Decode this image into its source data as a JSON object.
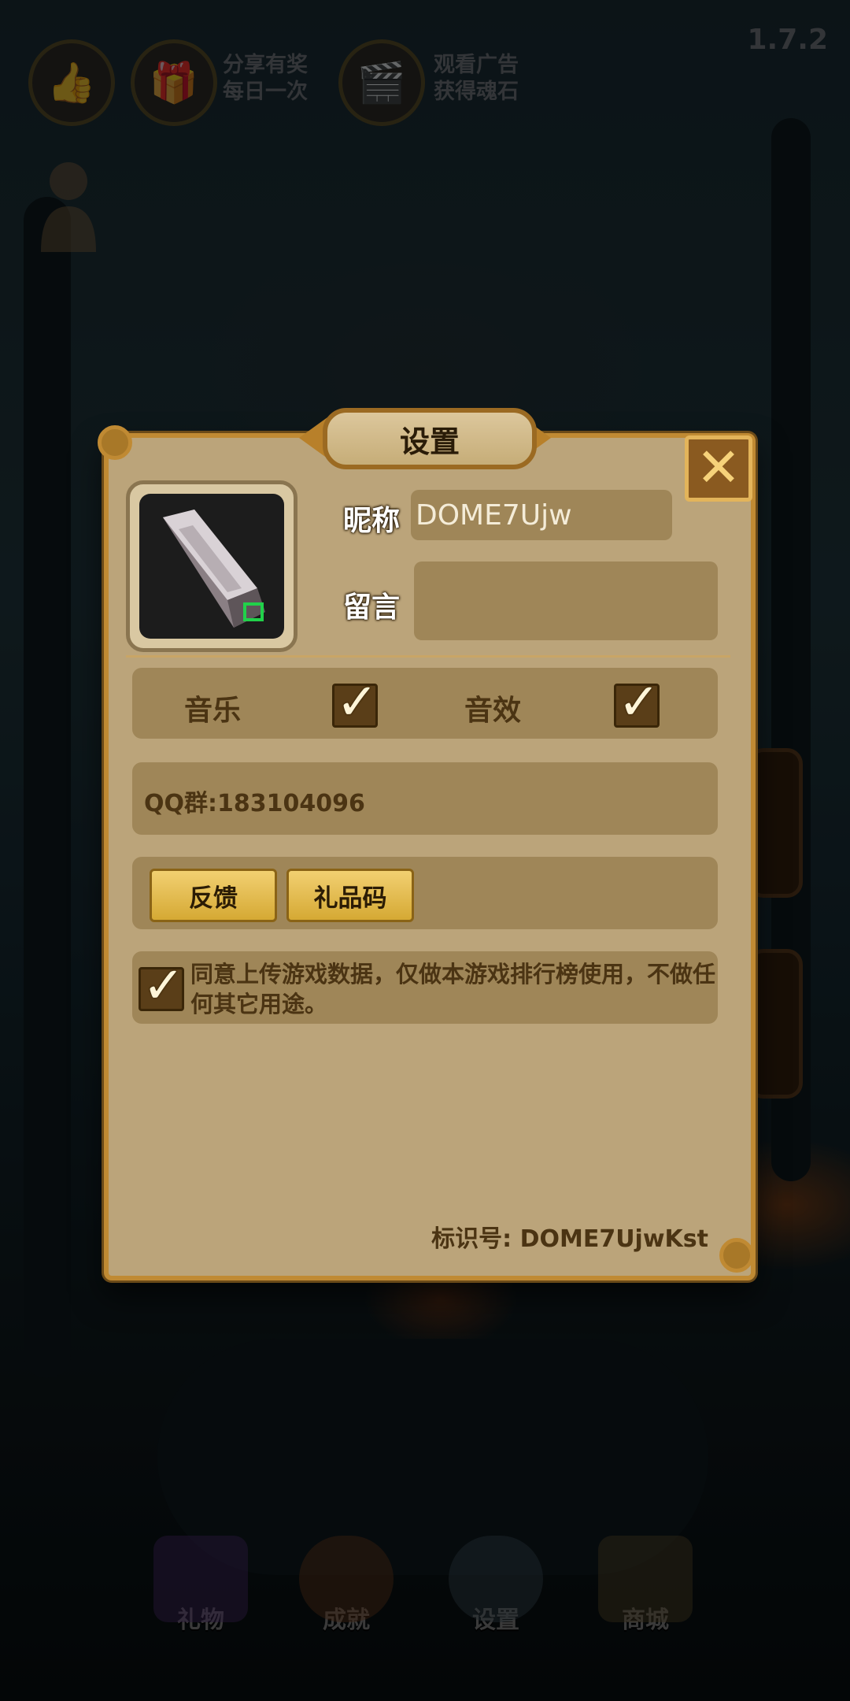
{
  "top": {
    "share": {
      "line1": "分享有奖",
      "line2": "每日一次"
    },
    "ad": {
      "line1": "观看广告",
      "line2": "获得魂石"
    },
    "version": "1.7.2"
  },
  "dialog": {
    "title": "设置",
    "nickname_label": "昵称",
    "nickname_value": "DOME7Ujw",
    "message_label": "留言",
    "message_value": "",
    "music_label": "音乐",
    "music_checked": true,
    "sfx_label": "音效",
    "sfx_checked": true,
    "qq_group": "QQ群:183104096",
    "feedback_button": "反馈",
    "gift_code_button": "礼品码",
    "agree_text": "同意上传游戏数据，仅做本游戏排行榜使用，不做任何其它用途。",
    "agree_checked": true,
    "identifier": "标识号: DOME7UjwKst"
  },
  "bottom_nav": {
    "gift": "礼物",
    "achievement": "成就",
    "settings": "设置",
    "shop": "商城"
  },
  "colors": {
    "panel": "#bba47a",
    "panel_border": "#c08a33",
    "section": "#9f8658",
    "button_yellow": "#e2bb50",
    "text_dark": "#4b3413"
  },
  "icons": {
    "thumbs_up": "thumbs-up-icon",
    "share": "share-gift-icon",
    "ad": "video-ad-icon",
    "avatar": "tablet-stone-avatar-icon",
    "close": "close-icon",
    "check": "check-icon"
  }
}
